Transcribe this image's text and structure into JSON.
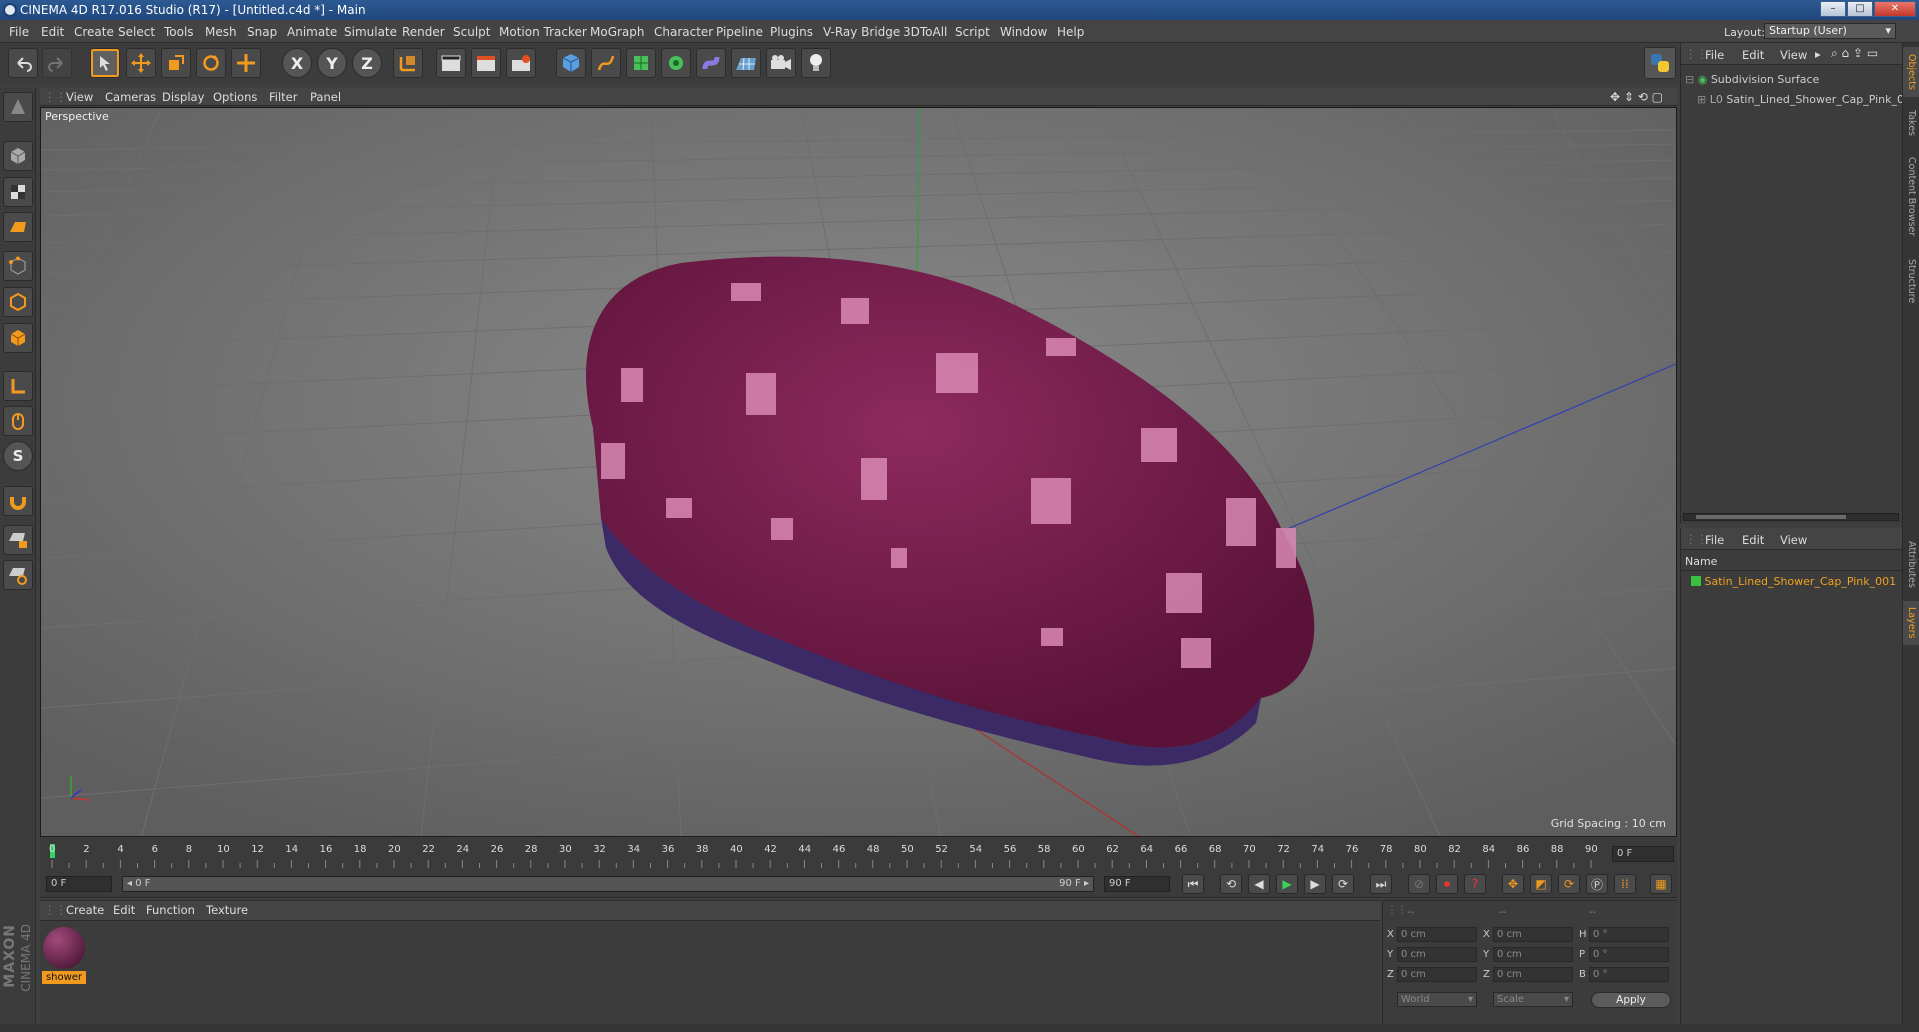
{
  "window": {
    "title": "CINEMA 4D R17.016 Studio (R17) - [Untitled.c4d *] - Main",
    "min": "–",
    "max": "□",
    "close": "✕"
  },
  "menubar": {
    "items": [
      "File",
      "Edit",
      "Create",
      "Select",
      "Tools",
      "Mesh",
      "Snap",
      "Animate",
      "Simulate",
      "Render",
      "Sculpt",
      "Motion Tracker",
      "MoGraph",
      "Character",
      "Pipeline",
      "Plugins",
      "V-Ray Bridge",
      "3DToAll",
      "Script",
      "Window",
      "Help"
    ],
    "layout_label": "Layout:",
    "layout_value": "Startup (User)"
  },
  "toolbar": {
    "axis_x": "X",
    "axis_y": "Y",
    "axis_z": "Z"
  },
  "viewport": {
    "menu": [
      "View",
      "Cameras",
      "Display",
      "Options",
      "Filter",
      "Panel"
    ],
    "camera_label": "Perspective",
    "grid_spacing": "Grid Spacing : 10 cm"
  },
  "timeline": {
    "ticks": [
      "0",
      "2",
      "4",
      "6",
      "8",
      "10",
      "12",
      "14",
      "16",
      "18",
      "20",
      "22",
      "24",
      "26",
      "28",
      "30",
      "32",
      "34",
      "36",
      "38",
      "40",
      "42",
      "44",
      "46",
      "48",
      "50",
      "52",
      "54",
      "56",
      "58",
      "60",
      "62",
      "64",
      "66",
      "68",
      "70",
      "72",
      "74",
      "76",
      "78",
      "80",
      "82",
      "84",
      "86",
      "88",
      "90"
    ],
    "current_frame": "0 F"
  },
  "playback": {
    "start_field": "0 F",
    "range_start": "◂ 0 F",
    "range_end": "90 F ▸",
    "end_field": "90 F"
  },
  "material_manager": {
    "menu": [
      "Create",
      "Edit",
      "Function",
      "Texture"
    ],
    "material_name": "shower"
  },
  "attributes": {
    "header": [
      "--",
      "--",
      "--"
    ],
    "rows": [
      {
        "a": "X",
        "av": "0 cm",
        "b": "X",
        "bv": "0 cm",
        "c": "H",
        "cv": "0 °"
      },
      {
        "a": "Y",
        "av": "0 cm",
        "b": "Y",
        "bv": "0 cm",
        "c": "P",
        "cv": "0 °"
      },
      {
        "a": "Z",
        "av": "0 cm",
        "b": "Z",
        "bv": "0 cm",
        "c": "B",
        "cv": "0 °"
      }
    ],
    "coord_mode": "World",
    "size_mode": "Scale",
    "apply_label": "Apply"
  },
  "object_manager": {
    "menu": [
      "File",
      "Edit",
      "View"
    ],
    "items": [
      {
        "name": "Subdivision Surface"
      },
      {
        "name": "Satin_Lined_Shower_Cap_Pink_001"
      }
    ]
  },
  "layer_manager": {
    "menu": [
      "File",
      "Edit",
      "View"
    ],
    "column": "Name",
    "items": [
      {
        "name": "Satin_Lined_Shower_Cap_Pink_001"
      }
    ]
  },
  "right_tabs": [
    "Objects",
    "Takes",
    "Content Browser",
    "Structure",
    "Attributes",
    "Layers"
  ],
  "branding": {
    "maxon": "MAXON",
    "product": "CINEMA 4D"
  },
  "colors": {
    "accent": "#f29a1e",
    "cap": "#7d1f4f",
    "cap_spot": "#d98ab4",
    "lining": "#3b2a66",
    "highlight_text": "#f0a020"
  }
}
